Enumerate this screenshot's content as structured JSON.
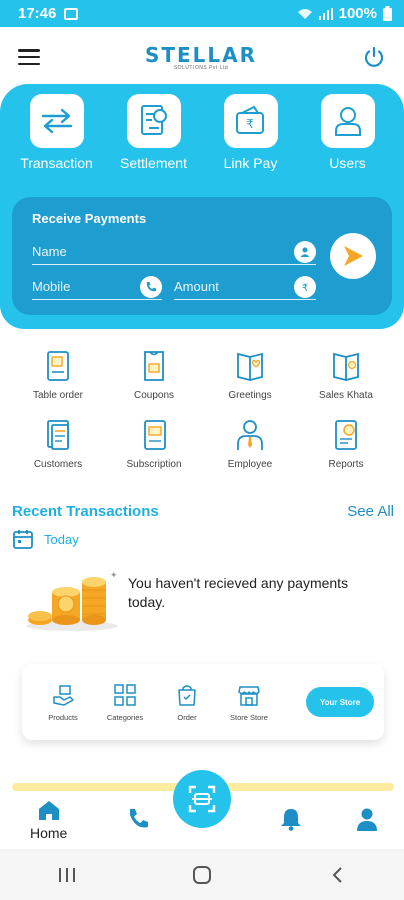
{
  "status_bar": {
    "time": "17:46",
    "battery": "100%"
  },
  "header": {
    "brand": "STELLAR",
    "brand_sub": "SOLUTIONS Pvt Ltd"
  },
  "quick_actions": [
    {
      "label": "Transaction",
      "icon": "arrows-swap-icon"
    },
    {
      "label": "Settlement",
      "icon": "document-settle-icon"
    },
    {
      "label": "Link Pay",
      "icon": "wallet-rupee-icon"
    },
    {
      "label": "Users",
      "icon": "user-icon"
    }
  ],
  "receive_payments": {
    "title": "Receive Payments",
    "name_placeholder": "Name",
    "mobile_placeholder": "Mobile",
    "amount_placeholder": "Amount"
  },
  "services": [
    {
      "label": "Table order",
      "icon": "table-order-icon"
    },
    {
      "label": "Coupons",
      "icon": "coupon-icon"
    },
    {
      "label": "Greetings",
      "icon": "greeting-card-icon"
    },
    {
      "label": "Sales Khata",
      "icon": "sales-khata-icon"
    },
    {
      "label": "Customers",
      "icon": "customers-icon"
    },
    {
      "label": "Subscription",
      "icon": "subscription-icon"
    },
    {
      "label": "Employee",
      "icon": "employee-icon"
    },
    {
      "label": "Reports",
      "icon": "reports-icon"
    }
  ],
  "recent": {
    "title": "Recent Transactions",
    "see_all": "See All",
    "today": "Today",
    "empty_message": "You haven't recieved any payments today."
  },
  "store": {
    "items": [
      {
        "label": "Products",
        "icon": "products-icon"
      },
      {
        "label": "Categories",
        "icon": "categories-icon"
      },
      {
        "label": "Order",
        "icon": "order-bag-icon"
      },
      {
        "label": "Store Store",
        "icon": "storefront-icon"
      }
    ],
    "your_store": "Your Store"
  },
  "bottom_nav": {
    "home": "Home"
  },
  "colors": {
    "primary": "#25c3ec",
    "card": "#1e9dd1",
    "accent": "#f5a623",
    "icon": "#1e8fc4"
  }
}
